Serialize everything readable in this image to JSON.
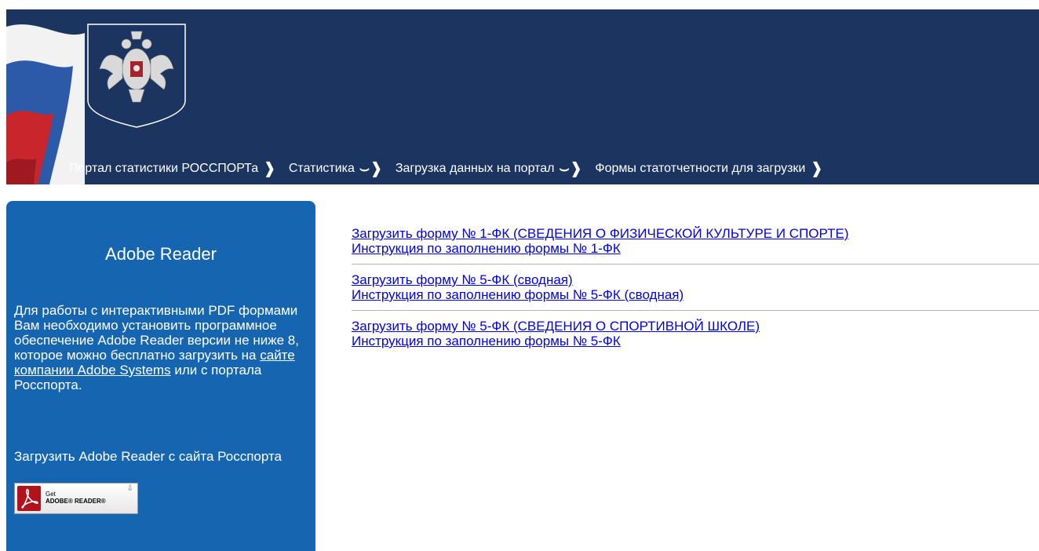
{
  "nav": [
    {
      "label": "Портал статистики РОССПОРТа"
    },
    {
      "label": "Статистика"
    },
    {
      "label": "Загрузка данных на портал"
    },
    {
      "label": "Формы статотчетности для загрузки"
    }
  ],
  "sidebar": {
    "title": "Adobe Reader",
    "text_before_link": "Для работы с интерактивными PDF формами Вам необходимо установить программное обеспечение Adobe Reader версии не ниже 8, которое можно бесплатно загрузить на ",
    "link": "сайте компании Adobe Systems",
    "text_after_link": " или с портала Росспорта.",
    "download_text": "Загрузить Adobe Reader с сайта Росспорта",
    "button": {
      "get": "Get",
      "product": "ADOBE® READER®"
    }
  },
  "content": {
    "groups": [
      {
        "download": "Загрузить форму № 1-ФК (СВЕДЕНИЯ О ФИЗИЧЕСКОЙ КУЛЬТУРЕ И СПОРТЕ)",
        "instruction": "Инструкция по заполнению формы № 1-ФК"
      },
      {
        "download": "Загрузить форму № 5-ФК (сводная)",
        "instruction": "Инструкция по заполнению формы № 5-ФК (сводная)"
      },
      {
        "download": "Загрузить форму № 5-ФК (СВЕДЕНИЯ О СПОРТИВНОЙ ШКОЛЕ)",
        "instruction": "Инструкция по заполнению формы № 5-ФК"
      }
    ]
  },
  "colors": {
    "header_bg": "#1b3560",
    "sidebar_bg": "#1565b0",
    "link": "#0000ee"
  }
}
